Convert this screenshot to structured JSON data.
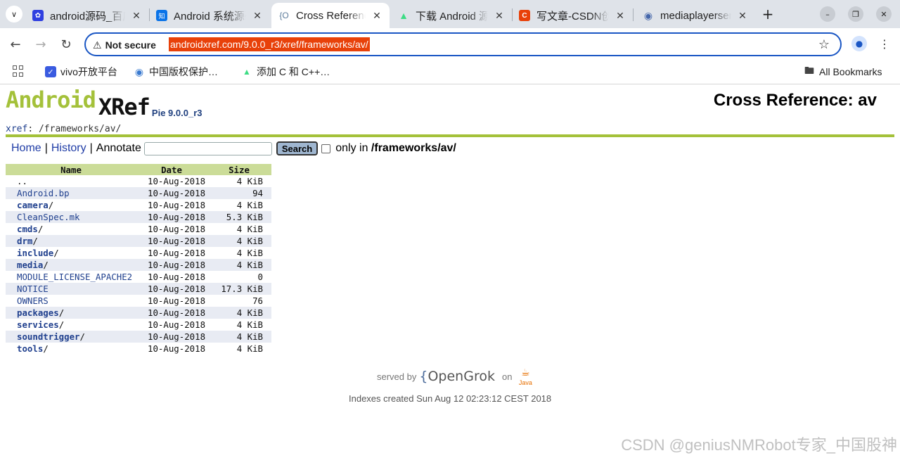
{
  "browser": {
    "tabs": [
      {
        "title": "android源码_百度搜索",
        "favicon": "paw-icon",
        "color": "#2f3fe0"
      },
      {
        "title": "Android 系统源码",
        "favicon": "zhi-icon",
        "color": "#0a73e8"
      },
      {
        "title": "Cross Reference: av",
        "favicon": "opengrok-icon",
        "color": "#5a7a9a"
      },
      {
        "title": "下载 Android 源码",
        "favicon": "android-icon",
        "color": "#3ddc84"
      },
      {
        "title": "写文章-CSDN创作中心",
        "favicon": "csdn-icon",
        "color": "#e8410a"
      },
      {
        "title": "mediaplayerservice",
        "favicon": "globe-icon",
        "color": "#4466aa"
      }
    ],
    "security_label": "Not secure",
    "url": "androidxref.com/9.0.0_r3/xref/frameworks/av/",
    "bookmarks": [
      {
        "label": "vivo开放平台"
      },
      {
        "label": "中国版权保护…"
      },
      {
        "label": "添加 C 和 C++…"
      }
    ],
    "all_bookmarks_label": "All Bookmarks"
  },
  "page": {
    "logo": {
      "android": "Android",
      "xref": "XRef",
      "version": "Pie 9.0.0_r3"
    },
    "header": "Cross Reference: av",
    "breadcrumb": {
      "xref": "xref",
      "sep": ":",
      "path": " /frameworks/av/"
    },
    "mast": {
      "home": "Home",
      "history": "History",
      "annotate": "Annotate",
      "search_button": "Search",
      "only_in": "only in",
      "only_in_path": "/frameworks/av/"
    },
    "table": {
      "headers": {
        "name": "Name",
        "date": "Date",
        "size": "Size"
      },
      "rows": [
        {
          "name": "..",
          "slash": "",
          "date": "10-Aug-2018",
          "size": "4 KiB",
          "type": "parent"
        },
        {
          "name": "Android.bp",
          "slash": "",
          "date": "10-Aug-2018",
          "size": "94",
          "type": "file"
        },
        {
          "name": "camera",
          "slash": "/",
          "date": "10-Aug-2018",
          "size": "4 KiB",
          "type": "dir"
        },
        {
          "name": "CleanSpec.mk",
          "slash": "",
          "date": "10-Aug-2018",
          "size": "5.3 KiB",
          "type": "file"
        },
        {
          "name": "cmds",
          "slash": "/",
          "date": "10-Aug-2018",
          "size": "4 KiB",
          "type": "dir"
        },
        {
          "name": "drm",
          "slash": "/",
          "date": "10-Aug-2018",
          "size": "4 KiB",
          "type": "dir"
        },
        {
          "name": "include",
          "slash": "/",
          "date": "10-Aug-2018",
          "size": "4 KiB",
          "type": "dir"
        },
        {
          "name": "media",
          "slash": "/",
          "date": "10-Aug-2018",
          "size": "4 KiB",
          "type": "dir"
        },
        {
          "name": "MODULE_LICENSE_APACHE2",
          "slash": "",
          "date": "10-Aug-2018",
          "size": "0",
          "type": "file"
        },
        {
          "name": "NOTICE",
          "slash": "",
          "date": "10-Aug-2018",
          "size": "17.3 KiB",
          "type": "file"
        },
        {
          "name": "OWNERS",
          "slash": "",
          "date": "10-Aug-2018",
          "size": "76",
          "type": "file"
        },
        {
          "name": "packages",
          "slash": "/",
          "date": "10-Aug-2018",
          "size": "4 KiB",
          "type": "dir"
        },
        {
          "name": "services",
          "slash": "/",
          "date": "10-Aug-2018",
          "size": "4 KiB",
          "type": "dir"
        },
        {
          "name": "soundtrigger",
          "slash": "/",
          "date": "10-Aug-2018",
          "size": "4 KiB",
          "type": "dir"
        },
        {
          "name": "tools",
          "slash": "/",
          "date": "10-Aug-2018",
          "size": "4 KiB",
          "type": "dir"
        }
      ]
    },
    "footer": {
      "served_by": "served by",
      "opengrok_open": "{",
      "opengrok_name": "OpenGrok",
      "on": "on",
      "java": "Java",
      "indexes": "Indexes created Sun Aug 12 02:23:12 CEST 2018"
    },
    "watermark": "CSDN @geniusNMRobot专家_中国股神"
  },
  "colors": {
    "accent_green": "#a4c13a",
    "link_blue": "#20408e",
    "url_highlight": "#e8410a",
    "header_row": "#cbdc98",
    "alt_row": "#e8ebf3"
  }
}
